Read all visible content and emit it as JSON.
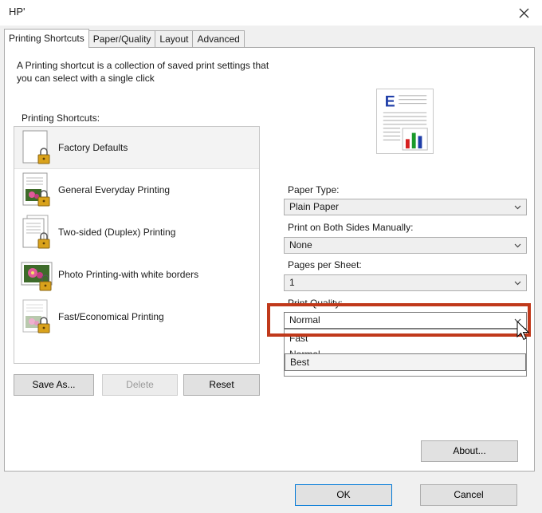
{
  "window": {
    "title": "HP'"
  },
  "tabs": [
    {
      "label": "Printing Shortcuts"
    },
    {
      "label": "Paper/Quality"
    },
    {
      "label": "Layout"
    },
    {
      "label": "Advanced"
    }
  ],
  "description": "A Printing shortcut is a collection of saved print settings that you can select with a single click",
  "shortcuts": {
    "label": "Printing Shortcuts:",
    "items": [
      {
        "label": "Factory Defaults"
      },
      {
        "label": "General Everyday Printing"
      },
      {
        "label": "Two-sided (Duplex) Printing"
      },
      {
        "label": "Photo Printing-with white borders"
      },
      {
        "label": "Fast/Economical Printing"
      }
    ]
  },
  "buttons": {
    "save_as": "Save As...",
    "delete": "Delete",
    "reset": "Reset",
    "about": "About...",
    "ok": "OK",
    "cancel": "Cancel"
  },
  "preview": {
    "letter": "E"
  },
  "fields": {
    "paper_type": {
      "label": "Paper Type:",
      "value": "Plain Paper"
    },
    "both_sides": {
      "label": "Print on Both Sides Manually:",
      "value": "None"
    },
    "pages_per_sheet": {
      "label": "Pages per Sheet:",
      "value": "1"
    },
    "print_quality": {
      "label": "Print Quality:",
      "value": "Normal",
      "options": [
        "Fast",
        "Normal",
        "Best"
      ]
    }
  },
  "colors": {
    "highlight": "#c0391b",
    "accent": "#0078d7"
  }
}
